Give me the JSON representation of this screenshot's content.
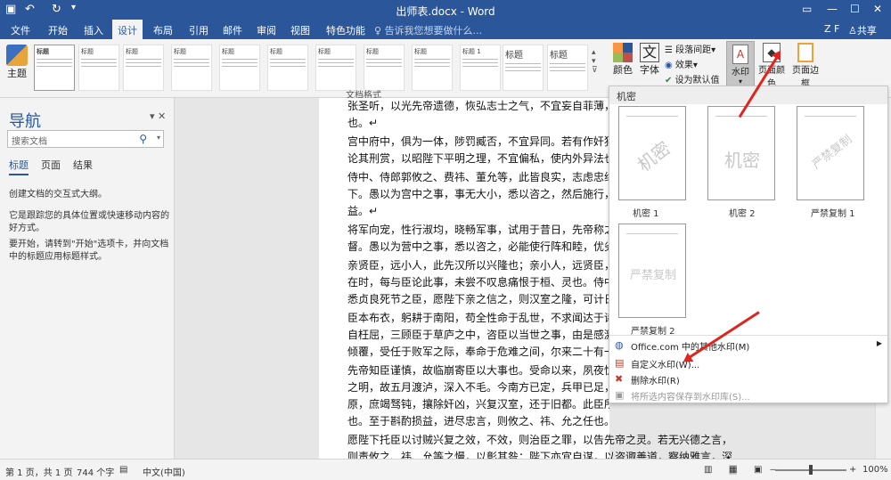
{
  "window": {
    "title": "出师表.docx - Word",
    "user": "Z F",
    "share": "共享"
  },
  "tabs": [
    {
      "label": "文件"
    },
    {
      "label": "开始"
    },
    {
      "label": "插入"
    },
    {
      "label": "设计"
    },
    {
      "label": "布局"
    },
    {
      "label": "引用"
    },
    {
      "label": "邮件"
    },
    {
      "label": "审阅"
    },
    {
      "label": "视图"
    },
    {
      "label": "特色功能"
    }
  ],
  "tellme": "告诉我您想要做什么...",
  "ribbon": {
    "theme": "主题",
    "group_label": "文档格式",
    "style_title": "标题",
    "style_title1": "标题 1",
    "colors": "颜色",
    "fonts": "字体",
    "paragraph_spacing": "段落间距",
    "effects": "效果",
    "set_default": "设为默认值",
    "watermark": "水印",
    "page_color": "页面颜色",
    "page_borders": "页面边框"
  },
  "nav": {
    "title": "导航",
    "search_placeholder": "搜索文档",
    "tabs": [
      "标题",
      "页面",
      "结果"
    ],
    "p1": "创建文档的交互式大纲。",
    "p2": "它是跟踪您的具体位置或快速移动内容的好方式。",
    "p3": "要开始，请转到\"开始\"选项卡，并向文档中的标题应用标题样式。"
  },
  "document": {
    "paragraphs": [
      "张圣听，以光先帝遗德，恢弘志士之气，不宜妄自菲薄，引",
      "也。↵",
      "宫中府中，俱为一体，陟罚臧否，不宜异同。若有作奸犯科",
      "论其刑赏，以昭陛下平明之理，不宜偏私，使内外异法也。",
      "侍中、侍郎郭攸之、费祎、董允等，此皆良实，志虑忠纯，",
      "下。愚以为宫中之事，事无大小，悉以咨之，然后施行，必",
      "益。↵",
      "将军向宠，性行淑均，晓畅军事，试用于昔日，先帝称之曰",
      "督。愚以为营中之事，悉以咨之，必能使行阵和睦，优劣得",
      "亲贤臣，远小人，此先汉所以兴隆也；亲小人，远贤臣，此",
      "在时，每与臣论此事，未尝不叹息痛恨于桓、灵也。侍中、",
      "悉贞良死节之臣，愿陛下亲之信之，则汉室之隆，可计日而",
      "臣本布衣，躬耕于南阳，苟全性命于乱世，不求闻达于诸侯",
      "自枉屈，三顾臣于草庐之中，咨臣以当世之事，由是感激，",
      "倾覆，受任于败军之际，奉命于危难之间，尔来二十有一年",
      "先帝知臣谨慎，故临崩寄臣以大事也。受命以来，夙夜忧叹",
      "之明，故五月渡泸，深入不毛。今南方已定，兵甲已足，",
      "原，庶竭驽钝，攘除奸凶，兴复汉室，还于旧都。此臣所以报先帝而忠陛下之职分",
      "也。至于斟酌损益，进尽忠言，则攸之、祎、允之任也。↵",
      "愿陛下托臣以讨贼兴复之效，不效，则治臣之罪，以告先帝之灵。若无兴德之言，",
      "则责攸之、祎、允等之慢，以彰其咎；陛下亦宜自谋，以咨诹善道，察纳雅言，深"
    ]
  },
  "watermark_menu": {
    "header": "机密",
    "items": [
      {
        "text": "机密",
        "caption": "机密 1"
      },
      {
        "text": "机密",
        "caption": "机密 2"
      },
      {
        "text": "严禁复制",
        "caption": "严禁复制 1"
      },
      {
        "text": "严禁复制",
        "caption": "严禁复制 2"
      }
    ],
    "more_online": "Office.com 中的其他水印(M)",
    "custom": "自定义水印(W)...",
    "remove": "删除水印(R)",
    "save_selection": "将所选内容保存到水印库(S)..."
  },
  "status": {
    "page": "第 1 页，共 1 页",
    "words": "744 个字",
    "language": "中文(中国)",
    "zoom": "100%"
  }
}
